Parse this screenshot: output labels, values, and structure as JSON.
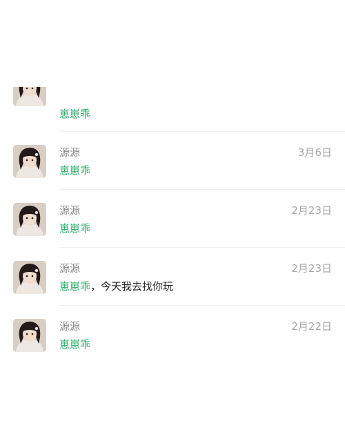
{
  "accent_color": "#2aae67",
  "comments": [
    {
      "avatar": "avatar-photo",
      "name": "",
      "date": "",
      "mention": "崽崽乖",
      "text": ""
    },
    {
      "avatar": "avatar-photo",
      "name": "源源",
      "date": "3月6日",
      "mention": "崽崽乖",
      "text": ""
    },
    {
      "avatar": "avatar-photo",
      "name": "源源",
      "date": "2月23日",
      "mention": "崽崽乖",
      "text": ""
    },
    {
      "avatar": "avatar-photo",
      "name": "源源",
      "date": "2月23日",
      "mention": "崽崽乖",
      "text": "，今天我去找你玩"
    },
    {
      "avatar": "avatar-photo",
      "name": "源源",
      "date": "2月22日",
      "mention": "崽崽乖",
      "text": ""
    }
  ]
}
